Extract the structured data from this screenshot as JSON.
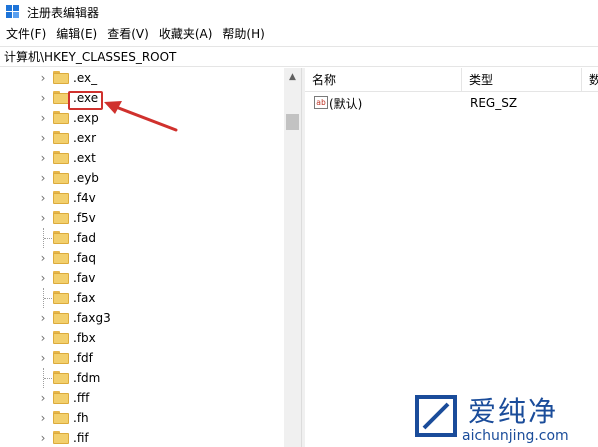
{
  "window": {
    "title": "注册表编辑器"
  },
  "menu": [
    "文件(F)",
    "编辑(E)",
    "查看(V)",
    "收藏夹(A)",
    "帮助(H)"
  ],
  "address": "计算机\\HKEY_CLASSES_ROOT",
  "tree": [
    {
      "label": ".ex_",
      "expandable": true
    },
    {
      "label": ".exe",
      "expandable": true,
      "highlighted": true
    },
    {
      "label": ".exp",
      "expandable": true
    },
    {
      "label": ".exr",
      "expandable": true
    },
    {
      "label": ".ext",
      "expandable": true
    },
    {
      "label": ".eyb",
      "expandable": true
    },
    {
      "label": ".f4v",
      "expandable": true
    },
    {
      "label": ".f5v",
      "expandable": true
    },
    {
      "label": ".fad",
      "expandable": false
    },
    {
      "label": ".faq",
      "expandable": true
    },
    {
      "label": ".fav",
      "expandable": true
    },
    {
      "label": ".fax",
      "expandable": false
    },
    {
      "label": ".faxg3",
      "expandable": true
    },
    {
      "label": ".fbx",
      "expandable": true
    },
    {
      "label": ".fdf",
      "expandable": true
    },
    {
      "label": ".fdm",
      "expandable": false
    },
    {
      "label": ".fff",
      "expandable": true
    },
    {
      "label": ".fh",
      "expandable": true
    },
    {
      "label": ".fif",
      "expandable": true
    }
  ],
  "list": {
    "columns": {
      "name": "名称",
      "type": "类型",
      "data": "数"
    },
    "rows": [
      {
        "icon": "ab",
        "name": "(默认)",
        "type": "REG_SZ"
      }
    ]
  },
  "watermark": {
    "text": "爱纯净",
    "url": "aichunjing.com"
  },
  "colors": {
    "highlight": "#d0312d",
    "folder": "#f2cf6c",
    "watermark": "#1a4c9a"
  }
}
